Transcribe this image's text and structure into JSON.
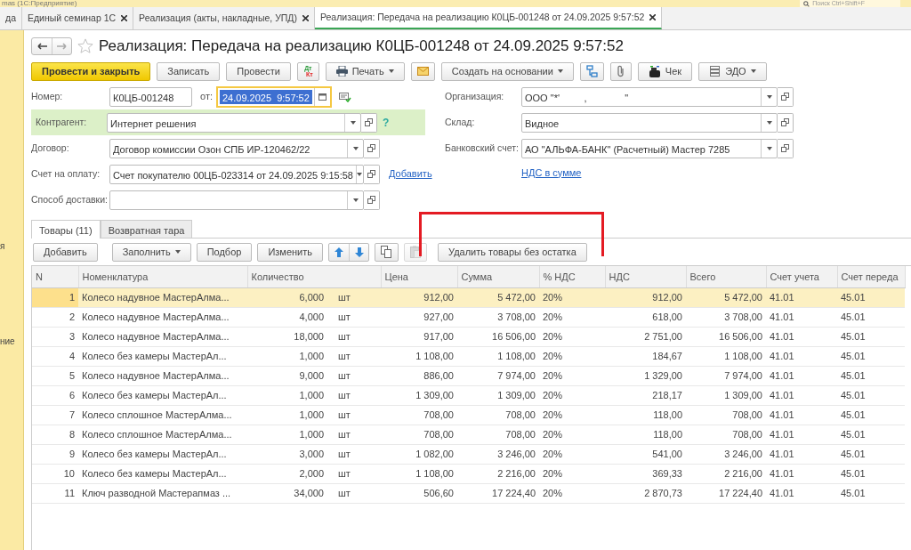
{
  "app_title": "mas (1С:Предприятие)",
  "search": {
    "placeholder": "Поиск Ctrl+Shift+F"
  },
  "tabs": [
    {
      "label": "да",
      "selected": false,
      "closable": false
    },
    {
      "label": "Единый семинар 1С",
      "selected": false,
      "closable": true
    },
    {
      "label": "Реализация (акты, накладные, УПД)",
      "selected": false,
      "closable": true
    },
    {
      "label": "Реализация: Передача на реализацию К0ЦБ-001248 от 24.09.2025 9:57:52",
      "selected": true,
      "closable": true
    }
  ],
  "sidebar": {
    "items": [
      {
        "label": "я"
      },
      {
        "label": "ние"
      }
    ]
  },
  "form": {
    "title": "Реализация: Передача на реализацию К0ЦБ-001248 от 24.09.2025 9:57:52",
    "favorite": false,
    "toolbar": [
      {
        "kind": "primary",
        "label": "Провести и закрыть"
      },
      {
        "kind": "plain",
        "label": "Записать"
      },
      {
        "kind": "plain",
        "label": "Провести"
      },
      {
        "kind": "dtkt",
        "labels": [
          "Дт",
          "Кт"
        ]
      },
      {
        "kind": "menu",
        "label": "Печать"
      },
      {
        "kind": "icon"
      },
      {
        "kind": "menu",
        "label": "Создать на основании"
      },
      {
        "kind": "icon"
      },
      {
        "kind": "icon"
      },
      {
        "kind": "plain",
        "label": "Чек"
      },
      {
        "kind": "menu",
        "label": "ЭДО"
      }
    ],
    "number": {
      "label": "Номер:",
      "value": "К0ЦБ-001248"
    },
    "date": {
      "label": "от:",
      "value": "24.09.2025  9:57:52",
      "focused": true
    },
    "left_fields": [
      {
        "label": "Контрагент:",
        "value": "Интернет решения",
        "highlighted": true,
        "help": "?"
      },
      {
        "label": "Договор:",
        "value": "Договор комиссии Озон СПБ ИР-120462/22",
        "highlighted": false
      },
      {
        "label": "Счет на оплату:",
        "value": "Счет покупателю 00ЦБ-023314 от 24.09.2025 9:15:58",
        "highlighted": false,
        "link": "Добавить"
      },
      {
        "label": "Способ доставки:",
        "highlighted": false
      }
    ],
    "right_fields": [
      {
        "label": "Организация:",
        "value": "ООО \"*'         ,              \""
      },
      {
        "label": "Склад:",
        "value": "Видное"
      },
      {
        "label": "Банковский счет:",
        "value": "АО \"АЛЬФА-БАНК\" (Расчетный) Мастер 7285"
      }
    ],
    "vat_link": "НДС в сумме",
    "inner_tabs": [
      {
        "label": "Товары (11)",
        "selected": true
      },
      {
        "label": "Возвратная тара",
        "selected": false
      }
    ],
    "table_toolbar": [
      {
        "kind": "plain",
        "label": "Добавить"
      },
      {
        "kind": "menu",
        "label": "Заполнить"
      },
      {
        "kind": "plain",
        "label": "Подбор"
      },
      {
        "kind": "plain",
        "label": "Изменить"
      },
      {
        "kind": "arrows"
      },
      {
        "kind": "icon"
      },
      {
        "kind": "icon",
        "disabled": true
      },
      {
        "kind": "plain",
        "label": "Удалить товары без остатка",
        "annotated": true
      }
    ],
    "table": {
      "columns": [
        "N",
        "Номенклатура",
        "Количество",
        null,
        "Цена",
        "Сумма",
        "% НДС",
        "НДС",
        "Всего",
        "Счет учета",
        "Счет переда"
      ],
      "rows": [
        {
          "selected": true,
          "cells": [
            "1",
            "Колесо надувное МастерАлма...",
            "6,000",
            "шт",
            "912,00",
            "5 472,00",
            "20%",
            "912,00",
            "5 472,00",
            "41.01",
            "45.01"
          ]
        },
        {
          "selected": false,
          "cells": [
            "2",
            "Колесо надувное МастерАлма...",
            "4,000",
            "шт",
            "927,00",
            "3 708,00",
            "20%",
            "618,00",
            "3 708,00",
            "41.01",
            "45.01"
          ]
        },
        {
          "selected": false,
          "cells": [
            "3",
            "Колесо надувное МастерАлма...",
            "18,000",
            "шт",
            "917,00",
            "16 506,00",
            "20%",
            "2 751,00",
            "16 506,00",
            "41.01",
            "45.01"
          ]
        },
        {
          "selected": false,
          "cells": [
            "4",
            "Колесо без камеры МастерАл...",
            "1,000",
            "шт",
            "1 108,00",
            "1 108,00",
            "20%",
            "184,67",
            "1 108,00",
            "41.01",
            "45.01"
          ]
        },
        {
          "selected": false,
          "cells": [
            "5",
            "Колесо надувное МастерАлма...",
            "9,000",
            "шт",
            "886,00",
            "7 974,00",
            "20%",
            "1 329,00",
            "7 974,00",
            "41.01",
            "45.01"
          ]
        },
        {
          "selected": false,
          "cells": [
            "6",
            "Колесо без камеры МастерАл...",
            "1,000",
            "шт",
            "1 309,00",
            "1 309,00",
            "20%",
            "218,17",
            "1 309,00",
            "41.01",
            "45.01"
          ]
        },
        {
          "selected": false,
          "cells": [
            "7",
            "Колесо сплошное МастерАлма...",
            "1,000",
            "шт",
            "708,00",
            "708,00",
            "20%",
            "118,00",
            "708,00",
            "41.01",
            "45.01"
          ]
        },
        {
          "selected": false,
          "cells": [
            "8",
            "Колесо сплошное МастерАлма...",
            "1,000",
            "шт",
            "708,00",
            "708,00",
            "20%",
            "118,00",
            "708,00",
            "41.01",
            "45.01"
          ]
        },
        {
          "selected": false,
          "cells": [
            "9",
            "Колесо без камеры МастерАл...",
            "3,000",
            "шт",
            "1 082,00",
            "3 246,00",
            "20%",
            "541,00",
            "3 246,00",
            "41.01",
            "45.01"
          ]
        },
        {
          "selected": false,
          "cells": [
            "10",
            "Колесо без камеры МастерАл...",
            "2,000",
            "шт",
            "1 108,00",
            "2 216,00",
            "20%",
            "369,33",
            "2 216,00",
            "41.01",
            "45.01"
          ]
        },
        {
          "selected": false,
          "cells": [
            "11",
            "Ключ разводной Мастерапмаз ...",
            "34,000",
            "шт",
            "506,60",
            "17 224,40",
            "20%",
            "2 870,73",
            "17 224,40",
            "41.01",
            "45.01"
          ]
        }
      ]
    }
  }
}
